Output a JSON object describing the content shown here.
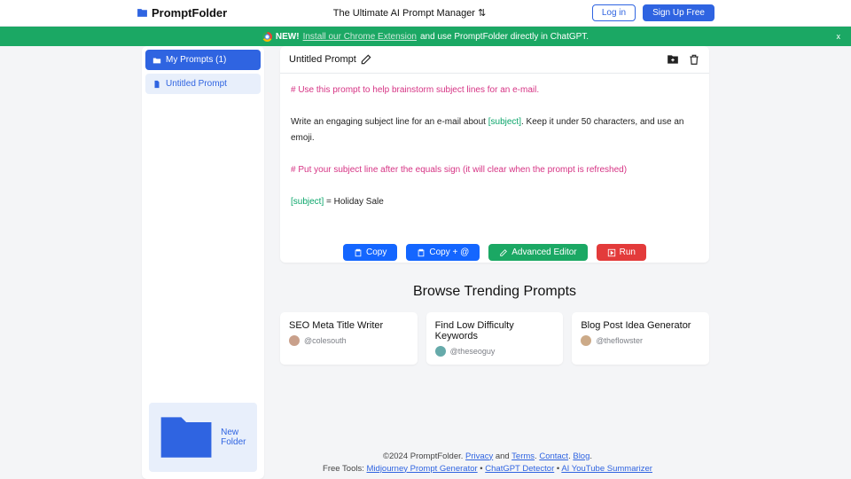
{
  "header": {
    "brand": "PromptFolder",
    "tagline": "The Ultimate AI Prompt Manager ⇅",
    "login": "Log in",
    "signup": "Sign Up Free"
  },
  "banner": {
    "new": "NEW!",
    "link": "Install our Chrome Extension",
    "rest": "and use PromptFolder directly in ChatGPT.",
    "close": "x"
  },
  "sidebar": {
    "root": "My Prompts (1)",
    "items": [
      "Untitled Prompt"
    ],
    "newFolder": "New Folder"
  },
  "prompt": {
    "title": "Untitled Prompt",
    "line1": "# Use this prompt to help brainstorm subject lines for an e-mail.",
    "line2a": "Write an engaging subject line for an e-mail about ",
    "line2v": "[subject]",
    "line2b": ". Keep it under 50 characters, and use an emoji.",
    "line3": "# Put your subject line after the equals sign (it will clear when the prompt is refreshed)",
    "line4v": "[subject]",
    "line4b": " = Holiday Sale"
  },
  "actions": {
    "copy": "Copy",
    "copyAt": "Copy + @",
    "adv": "Advanced Editor",
    "run": "Run"
  },
  "trending": {
    "title": "Browse Trending Prompts",
    "cards": [
      {
        "title": "SEO Meta Title Writer",
        "handle": "@colesouth"
      },
      {
        "title": "Find Low Difficulty Keywords",
        "handle": "@theseoguy"
      },
      {
        "title": "Blog Post Idea Generator",
        "handle": "@theflowster"
      }
    ]
  },
  "footer": {
    "line1a": "©2024 PromptFolder. ",
    "privacy": "Privacy",
    "and": " and ",
    "terms": "Terms",
    "sep": ". ",
    "contact": "Contact",
    "blog": "Blog",
    "line2a": "Free Tools: ",
    "t1": "Midjourney Prompt Generator",
    "t2": "ChatGPT Detector",
    "t3": "AI YouTube Summarizer",
    "bullet": " • "
  }
}
